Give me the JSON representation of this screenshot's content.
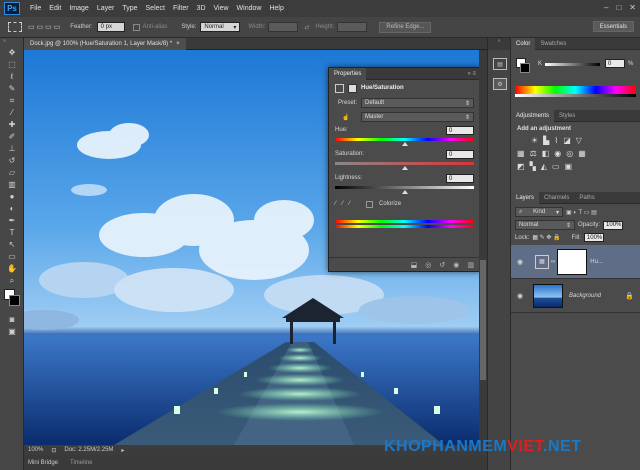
{
  "app": {
    "logo": "Ps"
  },
  "menu": [
    "File",
    "Edit",
    "Image",
    "Layer",
    "Type",
    "Select",
    "Filter",
    "3D",
    "View",
    "Window",
    "Help"
  ],
  "window_controls": [
    "–",
    "□",
    "✕"
  ],
  "options": {
    "feather_label": "Feather:",
    "feather_value": "0 px",
    "antialias_label": "Anti-alias",
    "style_label": "Style:",
    "style_value": "Normal",
    "width_label": "Width:",
    "height_label": "Height:",
    "refine_edge": "Refine Edge...",
    "workspace": "Essentials"
  },
  "document": {
    "tab_title": "Dock.jpg @ 100% (Hue/Saturation 1, Layer Mask/8) *",
    "zoom": "100%",
    "doc_size": "Doc: 2.25M/2.25M"
  },
  "bottom_tabs": [
    "Mini Bridge",
    "Timeline"
  ],
  "properties": {
    "tab": "Properties",
    "title": "Hue/Saturation",
    "preset_label": "Preset:",
    "preset_value": "Default",
    "channel_value": "Master",
    "hue_label": "Hue:",
    "hue_value": "0",
    "saturation_label": "Saturation:",
    "saturation_value": "0",
    "lightness_label": "Lightness:",
    "lightness_value": "0",
    "colorize_label": "Colorize"
  },
  "color_panel": {
    "tabs": [
      "Color",
      "Swatches"
    ],
    "k_label": "K",
    "k_value": "0",
    "percent": "%"
  },
  "adjustments": {
    "tabs": [
      "Adjustments",
      "Styles"
    ],
    "heading": "Add an adjustment"
  },
  "layers": {
    "tabs": [
      "Layers",
      "Channels",
      "Paths"
    ],
    "kind_value": "Kind",
    "blend_mode": "Normal",
    "opacity_label": "Opacity:",
    "opacity_value": "100%",
    "lock_label": "Lock:",
    "fill_label": "Fill:",
    "fill_value": "100%",
    "items": [
      {
        "name": "Hu..."
      },
      {
        "name": "Background"
      }
    ]
  },
  "watermark": {
    "part1": "KHOPHANMEM",
    "part2": "VIET",
    "part3": ".NET"
  }
}
